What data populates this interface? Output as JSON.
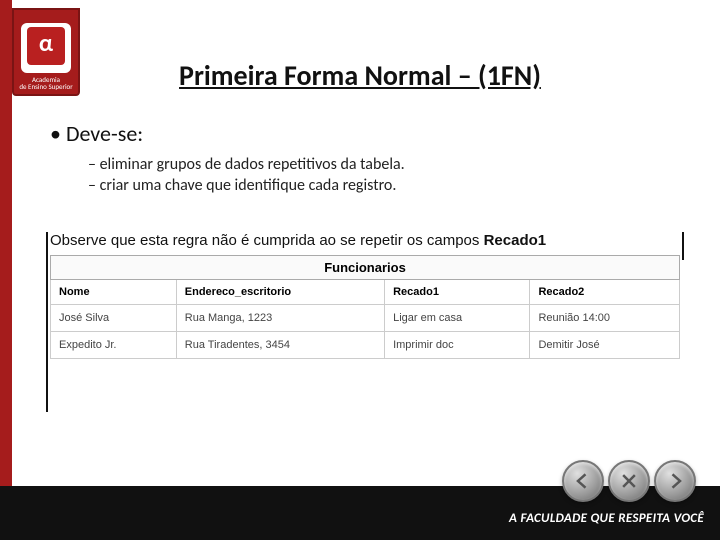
{
  "logo": {
    "glyph": "α",
    "label": "Academia",
    "sublabel": "de Ensino Superior"
  },
  "title": "Primeira Forma Normal – (1FN)",
  "bullet": "Deve-se:",
  "subitems": [
    "eliminar grupos de dados repetitivos da tabela.",
    "criar uma chave que identifique cada registro."
  ],
  "observe_prefix": "Observe que esta regra não é cumprida ao se repetir os campos ",
  "observe_bold": "Recado1",
  "table": {
    "caption": "Funcionarios",
    "headers": [
      "Nome",
      "Endereco_escritorio",
      "Recado1",
      "Recado2"
    ],
    "rows": [
      [
        "José Silva",
        "Rua Manga, 1223",
        "Ligar em casa",
        "Reunião 14:00"
      ],
      [
        "Expedito Jr.",
        "Rua Tiradentes, 3454",
        "Imprimir doc",
        "Demitir José"
      ]
    ]
  },
  "footer": "A FACULDADE QUE RESPEITA VOCÊ"
}
